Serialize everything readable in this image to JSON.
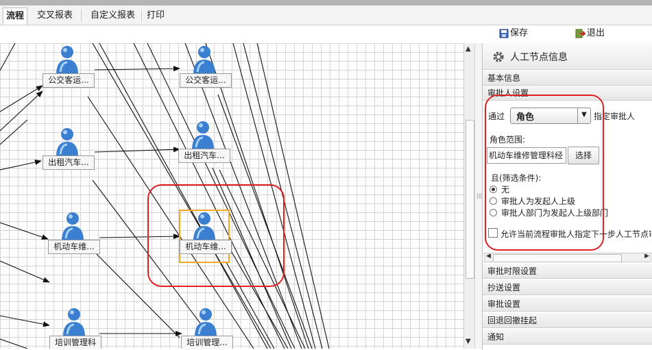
{
  "tabs": [
    {
      "label": "流程",
      "active": true
    },
    {
      "label": "交叉报表",
      "active": false
    },
    {
      "label": "自定义报表",
      "active": false
    },
    {
      "label": "打印",
      "active": false
    }
  ],
  "toolbar": {
    "save_label": "保存",
    "exit_label": "退出"
  },
  "nodes": [
    {
      "label": "公交客运..."
    },
    {
      "label": "公交客运..."
    },
    {
      "label": "出租汽车..."
    },
    {
      "label": "出租汽车..."
    },
    {
      "label": "机动车维..."
    },
    {
      "label": "机动车维..."
    },
    {
      "label": "培训管理科"
    },
    {
      "label": "培训管理..."
    }
  ],
  "panel": {
    "title": "人工节点信息",
    "sections": [
      "基本信息",
      "审批人设置",
      "审批时限设置",
      "抄送设置",
      "审批设置",
      "回退回撤挂起",
      "通知"
    ],
    "approver": {
      "via_label": "通过",
      "role_select": "角色",
      "assign_label": "指定审批人",
      "role_range_label": "角色范围:",
      "role_range_value": "机动车维修管理科经",
      "select_button": "选择",
      "filter_label": "且(筛选条件):",
      "options": [
        {
          "label": "无",
          "checked": true
        },
        {
          "label": "审批人为发起人上级",
          "checked": false
        },
        {
          "label": "审批人部门为发起人上级部门",
          "checked": false
        }
      ],
      "allow_label": "允许当前流程审批人指定下一步人工节点审"
    }
  },
  "colors": {
    "highlight_red": "#e02020",
    "selection_orange": "#f5a623",
    "person_blue": "#3a7fd0"
  }
}
